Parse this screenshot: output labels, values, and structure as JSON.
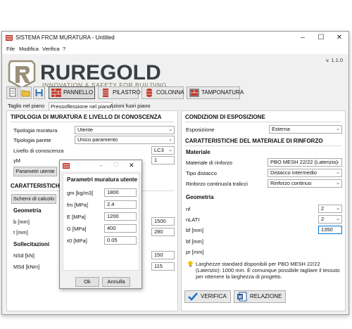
{
  "window": {
    "title": "SISTEMA FRCM MURATURA - Untitled"
  },
  "menu": {
    "items": [
      "File",
      "Modifica",
      "Verifica",
      "?"
    ]
  },
  "logo": {
    "name": "RUREGOLD",
    "tagline": "INNOVATION & SAFETY FOR BUILDING"
  },
  "version": "v. 1.1.0",
  "toolbar": {
    "buttons": [
      "PANNELLO",
      "PILASTRO",
      "COLONNA",
      "TAMPONATURA"
    ]
  },
  "tabs": [
    "Taglio nel piano",
    "Pressoflessione nel piano",
    "Azioni fuori piano"
  ],
  "left": {
    "section1": {
      "title": "TIPOLOGIA DI MURATURA E LIVELLO DI CONOSCENZA",
      "rows": [
        {
          "label": "Tipologia muratura",
          "value": "Utente"
        },
        {
          "label": "Tipologia parete",
          "value": "Unico paramento"
        }
      ],
      "knowledge_label": "Livello di conoscenza",
      "knowledge_value": "LC3",
      "gamma_label": "γM",
      "gamma_value": "1",
      "params_button": "Parametri utente"
    },
    "section2": {
      "title": "CARATTERISTICHE DELLA SEZIONE ESISTENTE",
      "schemi_button": "Schemi di calcolo",
      "geometria_title": "Geometria",
      "b_label": "b [mm]",
      "b_value": "1500",
      "t_label": "t [mm]",
      "t_value": "280",
      "solle_title": "Sollecitazioni",
      "nsd_label": "NSd [kN]",
      "nsd_value": "150",
      "msd_label": "MSd [kNm]",
      "msd_value": "115"
    }
  },
  "dialog": {
    "title": "Parametri muratura utente",
    "rows": [
      {
        "label": "gm [kg/m3]",
        "value": "1800"
      },
      {
        "label": "fm [MPa]",
        "value": "2.4"
      },
      {
        "label": "E [MPa]",
        "value": "1200"
      },
      {
        "label": "G [MPa]",
        "value": "400"
      },
      {
        "label": "τ0 [MPa]",
        "value": "0.05"
      }
    ],
    "ok": "Ok",
    "cancel": "Annulla"
  },
  "right": {
    "exposure": {
      "title": "CONDIZIONI DI ESPOSIZIONE",
      "label": "Esposizione",
      "value": "Esterna"
    },
    "material": {
      "title": "CARATTERISTICHE DEL MATERIALE DI RINFORZO",
      "sub": "Materiale",
      "rows": [
        {
          "label": "Materiale di rinforzo",
          "value": "PBO MESH 22/22 (Laterizio)"
        },
        {
          "label": "Tipo distacco",
          "value": "Distacco intermedio"
        },
        {
          "label": "Rinforzo continuo/a tralicci",
          "value": "Rinforzo continuo"
        }
      ]
    },
    "geometry": {
      "sub": "Geometria",
      "nf_label": "nf",
      "nf_value": "2",
      "nlati_label": "nLATI",
      "nlati_value": "2",
      "bf_label": "bf [mm]",
      "bf_value": "1350",
      "pf_label": "bf [mm]",
      "pr_label": "pr [mm]",
      "note": "Larghezze standard disponibili per PBO MESH 22/22 (Laterizio): 1000 mm. È comunque possibile tagliare il tessuto per ottenere la larghezza di progetto."
    },
    "verifica_button": "VERIFICA",
    "relazione_button": "RELAZIONE"
  }
}
